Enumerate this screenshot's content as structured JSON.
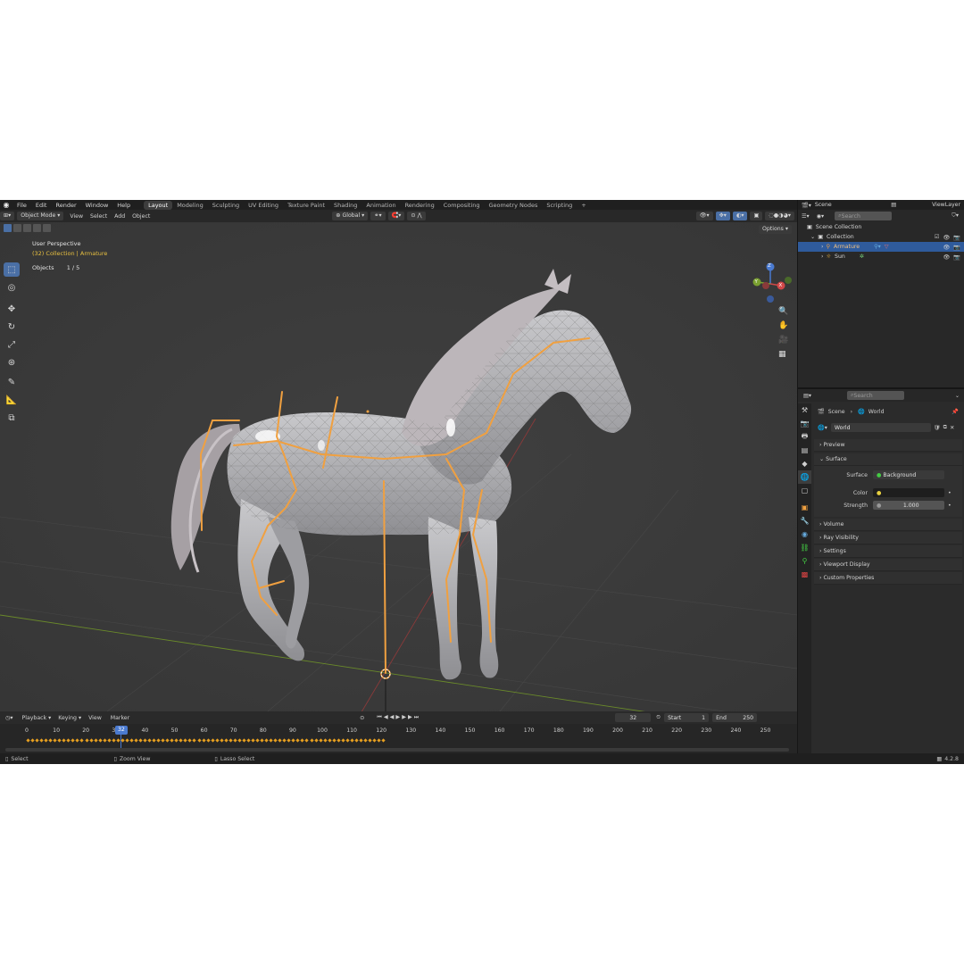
{
  "menu": {
    "items": [
      "File",
      "Edit",
      "Render",
      "Window",
      "Help"
    ]
  },
  "workspaces": {
    "tabs": [
      "Layout",
      "Modeling",
      "Sculpting",
      "UV Editing",
      "Texture Paint",
      "Shading",
      "Animation",
      "Rendering",
      "Compositing",
      "Geometry Nodes",
      "Scripting"
    ],
    "active": "Layout",
    "add": "+"
  },
  "viewport_header": {
    "mode": "Object Mode",
    "items": [
      "View",
      "Select",
      "Add",
      "Object"
    ],
    "orientation": "Global",
    "options": "Options"
  },
  "overlay": {
    "perspective": "User Perspective",
    "collection": "(32) Collection | Armature",
    "objects_label": "Objects",
    "objects_value": "1 / 5"
  },
  "gizmo": {
    "z": "Z",
    "y": "Y",
    "x": "X"
  },
  "outliner": {
    "header": {
      "scene": "Scene",
      "view_layer": "ViewLayer",
      "search_placeholder": "Search"
    },
    "rows": [
      "Scene Collection",
      "Collection",
      "Armature",
      "Sun"
    ]
  },
  "properties": {
    "search_placeholder": "Search",
    "breadcrumb": [
      "Scene",
      "World"
    ],
    "world_name": "World",
    "sections": {
      "preview": "Preview",
      "surface": "Surface",
      "volume": "Volume",
      "ray": "Ray Visibility",
      "settings": "Settings",
      "viewport": "Viewport Display",
      "custom": "Custom Properties"
    },
    "surface_label": "Surface",
    "surface_value": "Background",
    "color_label": "Color",
    "strength_label": "Strength",
    "strength_value": "1.000"
  },
  "timeline": {
    "menus": [
      "Playback",
      "Keying",
      "View",
      "Marker"
    ],
    "current_frame": "32",
    "start_label": "Start",
    "start": "1",
    "end_label": "End",
    "end": "250",
    "ticks": [
      "0",
      "10",
      "20",
      "30",
      "40",
      "50",
      "60",
      "70",
      "80",
      "90",
      "100",
      "110",
      "120",
      "130",
      "140",
      "150",
      "160",
      "170",
      "180",
      "190",
      "200",
      "210",
      "220",
      "230",
      "240",
      "250"
    ],
    "playhead": "32"
  },
  "status": {
    "select": "Select",
    "zoom": "Zoom View",
    "lasso": "Lasso Select",
    "version": "4.2.8"
  },
  "colors": {
    "accent": "#4a6fa5",
    "bone": "#f0a040",
    "selected": "#2f5b9c",
    "keyframe": "#e8a020"
  }
}
